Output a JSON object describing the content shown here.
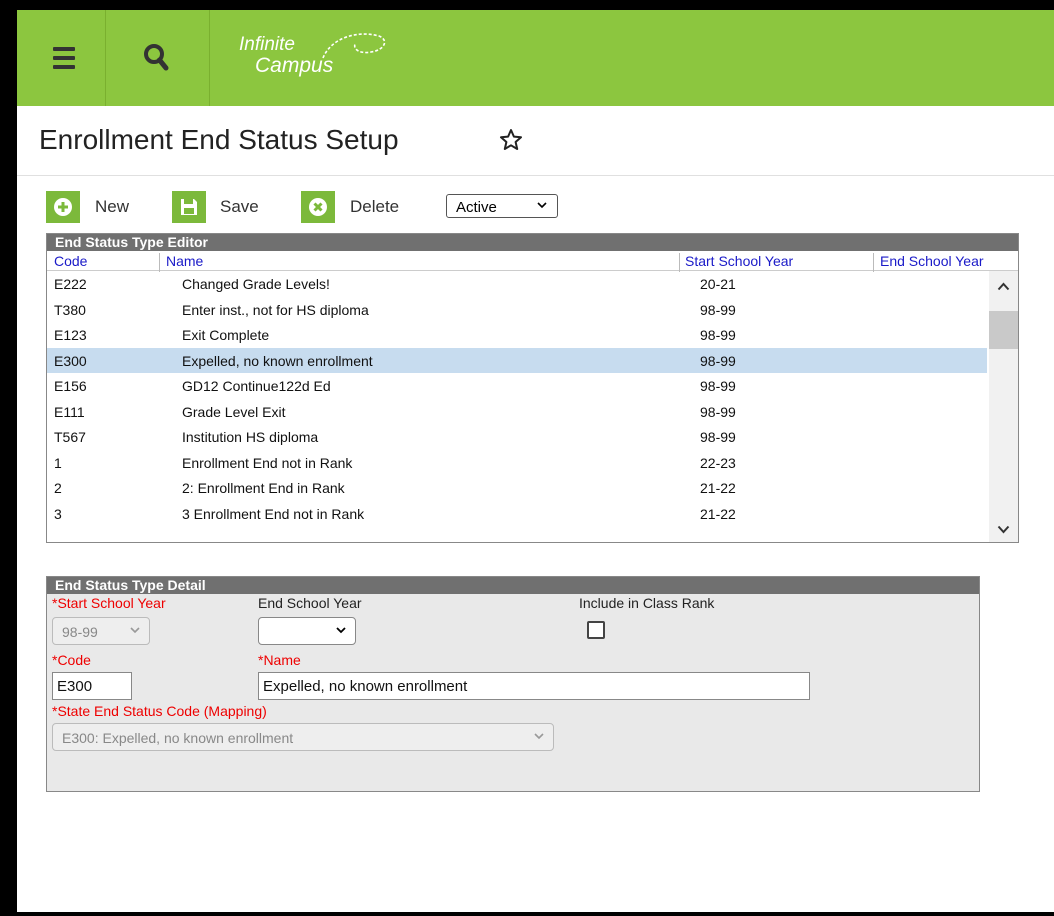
{
  "app": {
    "brand_line1": "Infinite",
    "brand_line2": "Campus"
  },
  "page": {
    "title": "Enrollment End Status Setup"
  },
  "toolbar": {
    "new_label": "New",
    "save_label": "Save",
    "delete_label": "Delete",
    "status_filter": "Active"
  },
  "editor": {
    "title": "End Status Type Editor",
    "columns": [
      "Code",
      "Name",
      "Start School Year",
      "End School Year"
    ],
    "rows": [
      {
        "code": "E222",
        "name": "Changed Grade Levels!",
        "start": "20-21",
        "end": ""
      },
      {
        "code": "T380",
        "name": "Enter inst., not for HS diploma",
        "start": "98-99",
        "end": ""
      },
      {
        "code": "E123",
        "name": "Exit Complete",
        "start": "98-99",
        "end": ""
      },
      {
        "code": "E300",
        "name": "Expelled, no known enrollment",
        "start": "98-99",
        "end": ""
      },
      {
        "code": "E156",
        "name": "GD12 Continue122d Ed",
        "start": "98-99",
        "end": ""
      },
      {
        "code": "E111",
        "name": "Grade Level Exit",
        "start": "98-99",
        "end": ""
      },
      {
        "code": "T567",
        "name": "Institution HS diploma",
        "start": "98-99",
        "end": ""
      },
      {
        "code": "1",
        "name": "Enrollment End not in Rank",
        "start": "22-23",
        "end": ""
      },
      {
        "code": "2",
        "name": "2: Enrollment End in Rank",
        "start": "21-22",
        "end": ""
      },
      {
        "code": "3",
        "name": "3 Enrollment End not in Rank",
        "start": "21-22",
        "end": ""
      }
    ],
    "selected_index": 3
  },
  "detail": {
    "title": "End Status Type Detail",
    "start_year_label": "*Start School Year",
    "start_year_value": "98-99",
    "end_year_label": "End School Year",
    "end_year_value": "",
    "class_rank_label": "Include in Class Rank",
    "class_rank_checked": false,
    "code_label": "*Code",
    "code_value": "E300",
    "name_label": "*Name",
    "name_value": "Expelled, no known enrollment",
    "mapping_label": "*State End Status Code (Mapping)",
    "mapping_value": "E300: Expelled, no known enrollment"
  },
  "colors": {
    "brand": "#8cc63f",
    "button": "#7cb93b",
    "header": "#707070",
    "required": "#e00000",
    "selected_row": "#c7dcef"
  }
}
